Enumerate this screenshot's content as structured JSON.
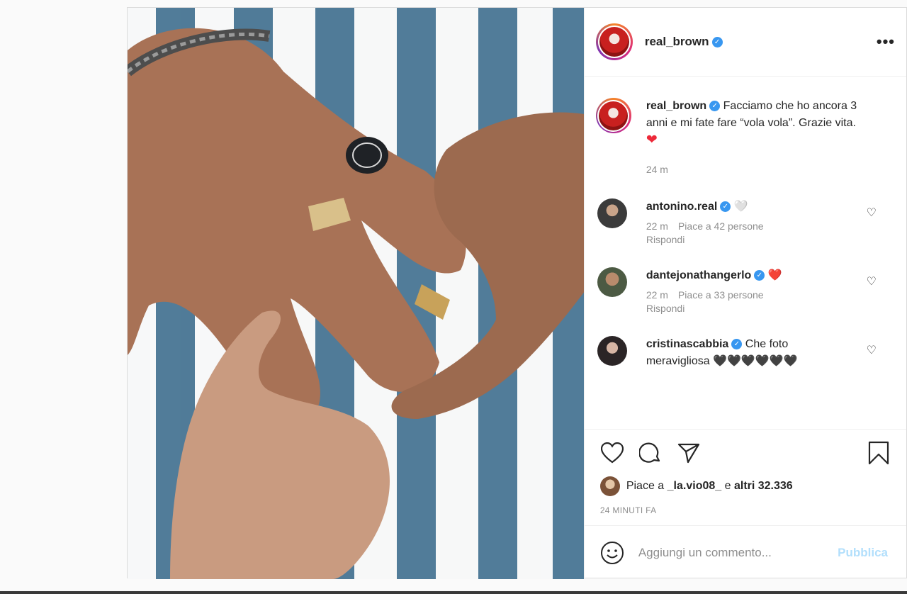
{
  "post": {
    "username": "real_brown",
    "more_icon": "more-horizontal-icon",
    "caption": {
      "username": "real_brown",
      "text": "Facciamo che ho ancora 3 anni e mi fate fare “vola vola”. Grazie vita.",
      "emoji": "❤",
      "time": "24 m"
    },
    "comments": [
      {
        "username": "antonino.real",
        "text": "🤍",
        "time": "22 m",
        "likes": "Piace a 42 persone",
        "reply": "Rispondi",
        "avatar_color": "#3b3b3b"
      },
      {
        "username": "dantejonathangerlo",
        "text": "❤️",
        "time": "22 m",
        "likes": "Piace a 33 persone",
        "reply": "Rispondi",
        "avatar_color": "#5a4a3c"
      },
      {
        "username": "cristinascabbia",
        "text": "Che foto meravigliosa 🖤🖤🖤🖤🖤🖤",
        "avatar_color": "#2b2526"
      }
    ],
    "likes_prefix": "Piace a",
    "likes_user": "_la.vio08_",
    "likes_mid": "e",
    "likes_count": "altri 32.336",
    "posted_ago": "24 MINUTI FA",
    "add_comment_placeholder": "Aggiungi un commento...",
    "publish_label": "Pubblica"
  },
  "colors": {
    "verified": "#3897f0",
    "publish": "#b2dffc",
    "heart": "#ed2939"
  }
}
